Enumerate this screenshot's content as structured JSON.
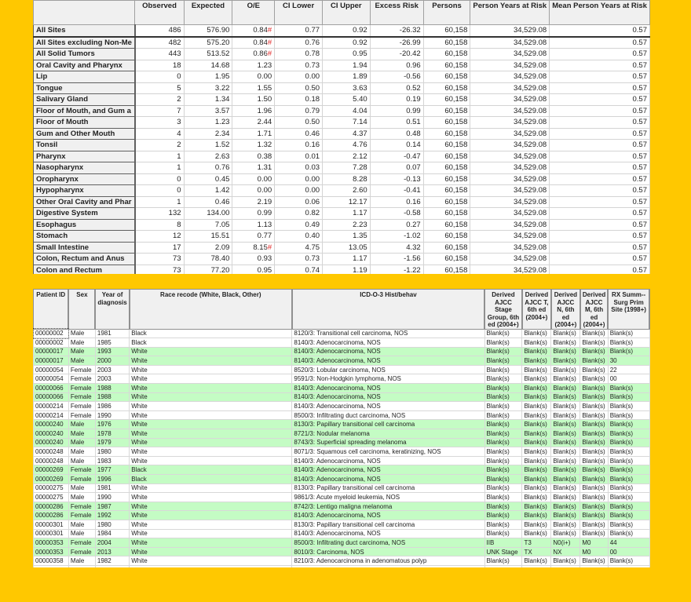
{
  "colors": {
    "background": "#FFC800",
    "highlight_row": "#C4FCC4",
    "flag": "#E02020"
  },
  "sir_table": {
    "columns": [
      "",
      "Observed",
      "Expected",
      "O/E",
      "CI Lower",
      "CI Upper",
      "Excess Risk",
      "Persons",
      "Person Years at Risk",
      "Mean Person Years at Risk"
    ],
    "rows": [
      [
        "All Sites",
        "486",
        "576.90",
        "0.84#",
        "0.77",
        "0.92",
        "-26.32",
        "60,158",
        "34,529.08",
        "0.57"
      ],
      [
        "All Sites excluding Non-Me",
        "482",
        "575.20",
        "0.84#",
        "0.76",
        "0.92",
        "-26.99",
        "60,158",
        "34,529.08",
        "0.57"
      ],
      [
        "All Solid Tumors",
        "443",
        "513.52",
        "0.86#",
        "0.78",
        "0.95",
        "-20.42",
        "60,158",
        "34,529.08",
        "0.57"
      ],
      [
        "Oral Cavity and Pharynx",
        "18",
        "14.68",
        "1.23",
        "0.73",
        "1.94",
        "0.96",
        "60,158",
        "34,529.08",
        "0.57"
      ],
      [
        "Lip",
        "0",
        "1.95",
        "0.00",
        "0.00",
        "1.89",
        "-0.56",
        "60,158",
        "34,529.08",
        "0.57"
      ],
      [
        "Tongue",
        "5",
        "3.22",
        "1.55",
        "0.50",
        "3.63",
        "0.52",
        "60,158",
        "34,529.08",
        "0.57"
      ],
      [
        "Salivary Gland",
        "2",
        "1.34",
        "1.50",
        "0.18",
        "5.40",
        "0.19",
        "60,158",
        "34,529.08",
        "0.57"
      ],
      [
        "Floor of Mouth, and Gum a",
        "7",
        "3.57",
        "1.96",
        "0.79",
        "4.04",
        "0.99",
        "60,158",
        "34,529.08",
        "0.57"
      ],
      [
        "Floor of Mouth",
        "3",
        "1.23",
        "2.44",
        "0.50",
        "7.14",
        "0.51",
        "60,158",
        "34,529.08",
        "0.57"
      ],
      [
        "Gum and Other Mouth",
        "4",
        "2.34",
        "1.71",
        "0.46",
        "4.37",
        "0.48",
        "60,158",
        "34,529.08",
        "0.57"
      ],
      [
        "Tonsil",
        "2",
        "1.52",
        "1.32",
        "0.16",
        "4.76",
        "0.14",
        "60,158",
        "34,529.08",
        "0.57"
      ],
      [
        "Pharynx",
        "1",
        "2.63",
        "0.38",
        "0.01",
        "2.12",
        "-0.47",
        "60,158",
        "34,529.08",
        "0.57"
      ],
      [
        "Nasopharynx",
        "1",
        "0.76",
        "1.31",
        "0.03",
        "7.28",
        "0.07",
        "60,158",
        "34,529.08",
        "0.57"
      ],
      [
        "Oropharynx",
        "0",
        "0.45",
        "0.00",
        "0.00",
        "8.28",
        "-0.13",
        "60,158",
        "34,529.08",
        "0.57"
      ],
      [
        "Hypopharynx",
        "0",
        "1.42",
        "0.00",
        "0.00",
        "2.60",
        "-0.41",
        "60,158",
        "34,529.08",
        "0.57"
      ],
      [
        "Other Oral Cavity and Phar",
        "1",
        "0.46",
        "2.19",
        "0.06",
        "12.17",
        "0.16",
        "60,158",
        "34,529.08",
        "0.57"
      ],
      [
        "Digestive System",
        "132",
        "134.00",
        "0.99",
        "0.82",
        "1.17",
        "-0.58",
        "60,158",
        "34,529.08",
        "0.57"
      ],
      [
        "Esophagus",
        "8",
        "7.05",
        "1.13",
        "0.49",
        "2.23",
        "0.27",
        "60,158",
        "34,529.08",
        "0.57"
      ],
      [
        "Stomach",
        "12",
        "15.51",
        "0.77",
        "0.40",
        "1.35",
        "-1.02",
        "60,158",
        "34,529.08",
        "0.57"
      ],
      [
        "Small Intestine",
        "17",
        "2.09",
        "8.15#",
        "4.75",
        "13.05",
        "4.32",
        "60,158",
        "34,529.08",
        "0.57"
      ],
      [
        "Colon, Rectum and Anus",
        "73",
        "78.40",
        "0.93",
        "0.73",
        "1.17",
        "-1.56",
        "60,158",
        "34,529.08",
        "0.57"
      ],
      [
        "Colon and Rectum",
        "73",
        "77.20",
        "0.95",
        "0.74",
        "1.19",
        "-1.22",
        "60,158",
        "34,529.08",
        "0.57"
      ]
    ]
  },
  "case_table": {
    "columns": [
      "Patient ID",
      "Sex",
      "Year of diagnosis",
      "Race recode (White, Black, Other)",
      "ICD-O-3 Hist/behav",
      "Derived AJCC Stage Group, 6th ed (2004+)",
      "Derived AJCC T, 6th ed (2004+)",
      "Derived AJCC N, 6th ed (2004+)",
      "Derived AJCC M, 6th ed (2004+)",
      "RX Summ--Surg Prim Site (1998+)"
    ],
    "rows": [
      {
        "hl": false,
        "cells": [
          "00000002",
          "Male",
          "1981",
          "Black",
          "8120/3: Transitional cell carcinoma, NOS",
          "Blank(s)",
          "Blank(s)",
          "Blank(s)",
          "Blank(s)",
          "Blank(s)"
        ]
      },
      {
        "hl": false,
        "cells": [
          "00000002",
          "Male",
          "1985",
          "Black",
          "8140/3: Adenocarcinoma, NOS",
          "Blank(s)",
          "Blank(s)",
          "Blank(s)",
          "Blank(s)",
          "Blank(s)"
        ]
      },
      {
        "hl": true,
        "cells": [
          "00000017",
          "Male",
          "1993",
          "White",
          "8140/3: Adenocarcinoma, NOS",
          "Blank(s)",
          "Blank(s)",
          "Blank(s)",
          "Blank(s)",
          "Blank(s)"
        ]
      },
      {
        "hl": true,
        "cells": [
          "00000017",
          "Male",
          "2000",
          "White",
          "8140/3: Adenocarcinoma, NOS",
          "Blank(s)",
          "Blank(s)",
          "Blank(s)",
          "Blank(s)",
          "30"
        ]
      },
      {
        "hl": false,
        "cells": [
          "00000054",
          "Female",
          "2003",
          "White",
          "8520/3: Lobular carcinoma, NOS",
          "Blank(s)",
          "Blank(s)",
          "Blank(s)",
          "Blank(s)",
          "22"
        ]
      },
      {
        "hl": false,
        "cells": [
          "00000054",
          "Female",
          "2003",
          "White",
          "9591/3: Non-Hodgkin lymphoma, NOS",
          "Blank(s)",
          "Blank(s)",
          "Blank(s)",
          "Blank(s)",
          "00"
        ]
      },
      {
        "hl": true,
        "cells": [
          "00000066",
          "Female",
          "1988",
          "White",
          "8140/3: Adenocarcinoma, NOS",
          "Blank(s)",
          "Blank(s)",
          "Blank(s)",
          "Blank(s)",
          "Blank(s)"
        ]
      },
      {
        "hl": true,
        "cells": [
          "00000066",
          "Female",
          "1988",
          "White",
          "8140/3: Adenocarcinoma, NOS",
          "Blank(s)",
          "Blank(s)",
          "Blank(s)",
          "Blank(s)",
          "Blank(s)"
        ]
      },
      {
        "hl": false,
        "cells": [
          "00000214",
          "Female",
          "1986",
          "White",
          "8140/3: Adenocarcinoma, NOS",
          "Blank(s)",
          "Blank(s)",
          "Blank(s)",
          "Blank(s)",
          "Blank(s)"
        ]
      },
      {
        "hl": false,
        "cells": [
          "00000214",
          "Female",
          "1990",
          "White",
          "8500/3: Infiltrating duct carcinoma, NOS",
          "Blank(s)",
          "Blank(s)",
          "Blank(s)",
          "Blank(s)",
          "Blank(s)"
        ]
      },
      {
        "hl": true,
        "cells": [
          "00000240",
          "Male",
          "1976",
          "White",
          "8130/3: Papillary transitional cell carcinoma",
          "Blank(s)",
          "Blank(s)",
          "Blank(s)",
          "Blank(s)",
          "Blank(s)"
        ]
      },
      {
        "hl": true,
        "cells": [
          "00000240",
          "Male",
          "1978",
          "White",
          "8721/3: Nodular melanoma",
          "Blank(s)",
          "Blank(s)",
          "Blank(s)",
          "Blank(s)",
          "Blank(s)"
        ]
      },
      {
        "hl": true,
        "cells": [
          "00000240",
          "Male",
          "1979",
          "White",
          "8743/3: Superficial spreading melanoma",
          "Blank(s)",
          "Blank(s)",
          "Blank(s)",
          "Blank(s)",
          "Blank(s)"
        ]
      },
      {
        "hl": false,
        "cells": [
          "00000248",
          "Male",
          "1980",
          "White",
          "8071/3: Squamous cell carcinoma, keratinizing, NOS",
          "Blank(s)",
          "Blank(s)",
          "Blank(s)",
          "Blank(s)",
          "Blank(s)"
        ]
      },
      {
        "hl": false,
        "cells": [
          "00000248",
          "Male",
          "1983",
          "White",
          "8140/3: Adenocarcinoma, NOS",
          "Blank(s)",
          "Blank(s)",
          "Blank(s)",
          "Blank(s)",
          "Blank(s)"
        ]
      },
      {
        "hl": true,
        "cells": [
          "00000269",
          "Female",
          "1977",
          "Black",
          "8140/3: Adenocarcinoma, NOS",
          "Blank(s)",
          "Blank(s)",
          "Blank(s)",
          "Blank(s)",
          "Blank(s)"
        ]
      },
      {
        "hl": true,
        "cells": [
          "00000269",
          "Female",
          "1996",
          "Black",
          "8140/3: Adenocarcinoma, NOS",
          "Blank(s)",
          "Blank(s)",
          "Blank(s)",
          "Blank(s)",
          "Blank(s)"
        ]
      },
      {
        "hl": false,
        "cells": [
          "00000275",
          "Male",
          "1981",
          "White",
          "8130/3: Papillary transitional cell carcinoma",
          "Blank(s)",
          "Blank(s)",
          "Blank(s)",
          "Blank(s)",
          "Blank(s)"
        ]
      },
      {
        "hl": false,
        "cells": [
          "00000275",
          "Male",
          "1990",
          "White",
          "9861/3: Acute myeloid leukemia, NOS",
          "Blank(s)",
          "Blank(s)",
          "Blank(s)",
          "Blank(s)",
          "Blank(s)"
        ]
      },
      {
        "hl": true,
        "cells": [
          "00000286",
          "Female",
          "1987",
          "White",
          "8742/3: Lentigo maligna melanoma",
          "Blank(s)",
          "Blank(s)",
          "Blank(s)",
          "Blank(s)",
          "Blank(s)"
        ]
      },
      {
        "hl": true,
        "cells": [
          "00000286",
          "Female",
          "1992",
          "White",
          "8140/3: Adenocarcinoma, NOS",
          "Blank(s)",
          "Blank(s)",
          "Blank(s)",
          "Blank(s)",
          "Blank(s)"
        ]
      },
      {
        "hl": false,
        "cells": [
          "00000301",
          "Male",
          "1980",
          "White",
          "8130/3: Papillary transitional cell carcinoma",
          "Blank(s)",
          "Blank(s)",
          "Blank(s)",
          "Blank(s)",
          "Blank(s)"
        ]
      },
      {
        "hl": false,
        "cells": [
          "00000301",
          "Male",
          "1984",
          "White",
          "8140/3: Adenocarcinoma, NOS",
          "Blank(s)",
          "Blank(s)",
          "Blank(s)",
          "Blank(s)",
          "Blank(s)"
        ]
      },
      {
        "hl": true,
        "cells": [
          "00000353",
          "Female",
          "2004",
          "White",
          "8500/3: Infiltrating duct carcinoma, NOS",
          "IIB",
          "T3",
          "N0(i+)",
          "M0",
          "44"
        ]
      },
      {
        "hl": true,
        "cells": [
          "00000353",
          "Female",
          "2013",
          "White",
          "8010/3: Carcinoma, NOS",
          "UNK Stage",
          "TX",
          "NX",
          "M0",
          "00"
        ]
      },
      {
        "hl": false,
        "cells": [
          "00000358",
          "Male",
          "1982",
          "White",
          "8210/3: Adenocarcinoma in adenomatous polyp",
          "Blank(s)",
          "Blank(s)",
          "Blank(s)",
          "Blank(s)",
          "Blank(s)"
        ]
      },
      {
        "hl": false,
        "cells": [
          "00000358",
          "Male",
          "1983",
          "White",
          "8140/3: Adenocarcinoma, NOS",
          "Blank(s)",
          "Blank(s)",
          "Blank(s)",
          "Blank(s)",
          "Blank(s)"
        ]
      }
    ]
  }
}
